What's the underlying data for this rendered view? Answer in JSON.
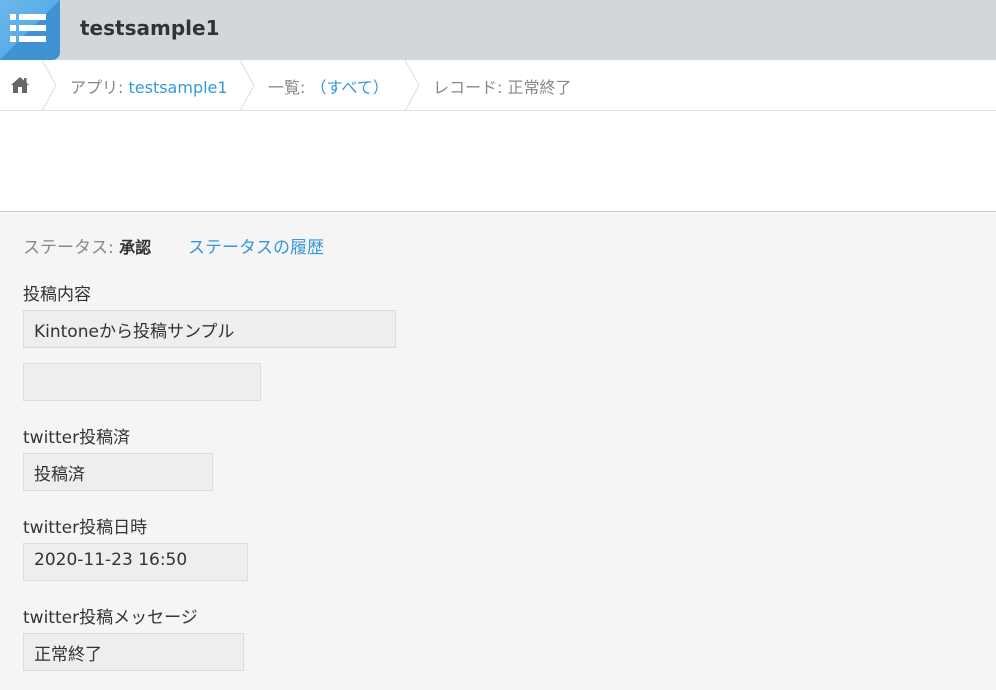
{
  "header": {
    "app_title": "testsample1",
    "app_icon": "list-icon"
  },
  "breadcrumb": {
    "home_icon": "home-icon",
    "app_prefix": "アプリ: ",
    "app_name": "testsample1",
    "list_prefix": "一覧: ",
    "list_name": "（すべて）",
    "record": "レコード: 正常終了"
  },
  "status": {
    "label": "ステータス: ",
    "value": "承認",
    "history_link": "ステータスの履歴"
  },
  "fields": [
    {
      "label": "投稿内容",
      "value": "Kintoneから投稿サンプル"
    },
    {
      "label": "",
      "value": ""
    },
    {
      "label": "twitter投稿済",
      "value": "投稿済"
    },
    {
      "label": "twitter投稿日時",
      "value": "2020-11-23 16:50"
    },
    {
      "label": "twitter投稿メッセージ",
      "value": "正常終了"
    }
  ],
  "colors": {
    "accent": "#3498db",
    "header_bg": "#d4d7d9",
    "icon_bg": "#4fa3e0"
  }
}
